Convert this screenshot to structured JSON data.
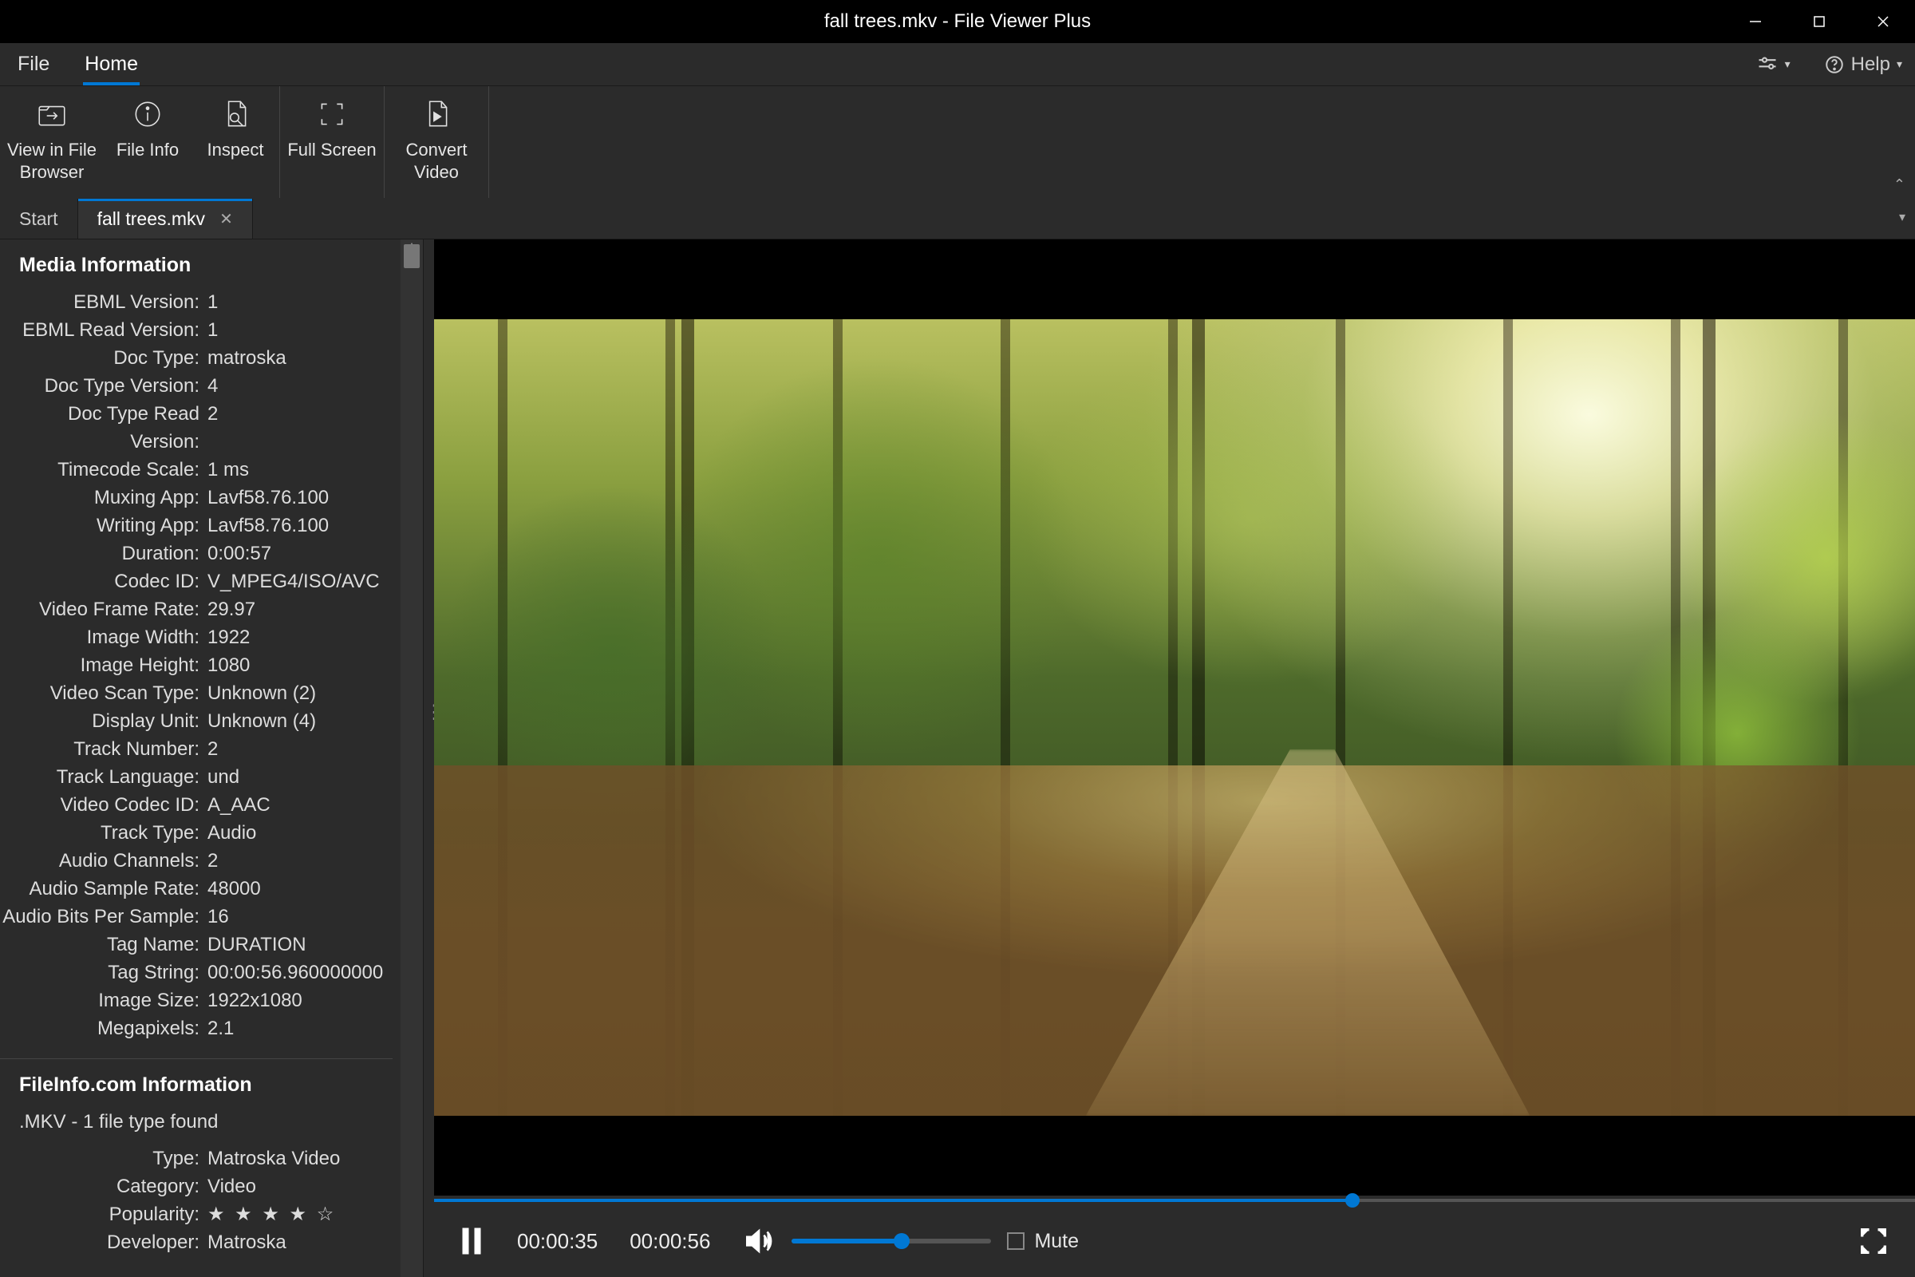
{
  "window": {
    "title": "fall trees.mkv - File Viewer Plus"
  },
  "menubar": {
    "file": "File",
    "home": "Home",
    "help": "Help"
  },
  "ribbon": {
    "view_in_browser": "View in File\nBrowser",
    "file_info": "File Info",
    "inspect": "Inspect",
    "full_screen": "Full Screen",
    "convert_video": "Convert\nVideo"
  },
  "tabs": {
    "start": "Start",
    "file": "fall trees.mkv"
  },
  "media_info": {
    "heading": "Media Information",
    "rows": [
      {
        "k": "EBML Version:",
        "v": "1"
      },
      {
        "k": "EBML Read Version:",
        "v": "1"
      },
      {
        "k": "Doc Type:",
        "v": "matroska"
      },
      {
        "k": "Doc Type Version:",
        "v": "4"
      },
      {
        "k": "Doc Type Read Version:",
        "v": "2"
      },
      {
        "k": "Timecode Scale:",
        "v": "1 ms"
      },
      {
        "k": "Muxing App:",
        "v": "Lavf58.76.100"
      },
      {
        "k": "Writing App:",
        "v": "Lavf58.76.100"
      },
      {
        "k": "Duration:",
        "v": "0:00:57"
      },
      {
        "k": "Codec ID:",
        "v": "V_MPEG4/ISO/AVC"
      },
      {
        "k": "Video Frame Rate:",
        "v": "29.97"
      },
      {
        "k": "Image Width:",
        "v": "1922"
      },
      {
        "k": "Image Height:",
        "v": "1080"
      },
      {
        "k": "Video Scan Type:",
        "v": "Unknown (2)"
      },
      {
        "k": "Display Unit:",
        "v": "Unknown (4)"
      },
      {
        "k": "Track Number:",
        "v": "2"
      },
      {
        "k": "Track Language:",
        "v": "und"
      },
      {
        "k": "Video Codec ID:",
        "v": "A_AAC"
      },
      {
        "k": "Track Type:",
        "v": "Audio"
      },
      {
        "k": "Audio Channels:",
        "v": "2"
      },
      {
        "k": "Audio Sample Rate:",
        "v": "48000"
      },
      {
        "k": "Audio Bits Per Sample:",
        "v": "16"
      },
      {
        "k": "Tag Name:",
        "v": "DURATION"
      },
      {
        "k": "Tag String:",
        "v": "00:00:56.960000000"
      },
      {
        "k": "Image Size:",
        "v": "1922x1080"
      },
      {
        "k": "Megapixels:",
        "v": "2.1"
      }
    ]
  },
  "fileinfo": {
    "heading": "FileInfo.com Information",
    "sub": ".MKV - 1 file type found",
    "rows": [
      {
        "k": "Type:",
        "v": "Matroska Video"
      },
      {
        "k": "Category:",
        "v": "Video"
      },
      {
        "k": "Popularity:",
        "v": "★ ★ ★ ★ ☆"
      },
      {
        "k": "Developer:",
        "v": "Matroska"
      }
    ]
  },
  "player": {
    "current": "00:00:35",
    "total": "00:00:56",
    "mute_label": "Mute",
    "progress_pct": 62,
    "volume_pct": 55
  }
}
